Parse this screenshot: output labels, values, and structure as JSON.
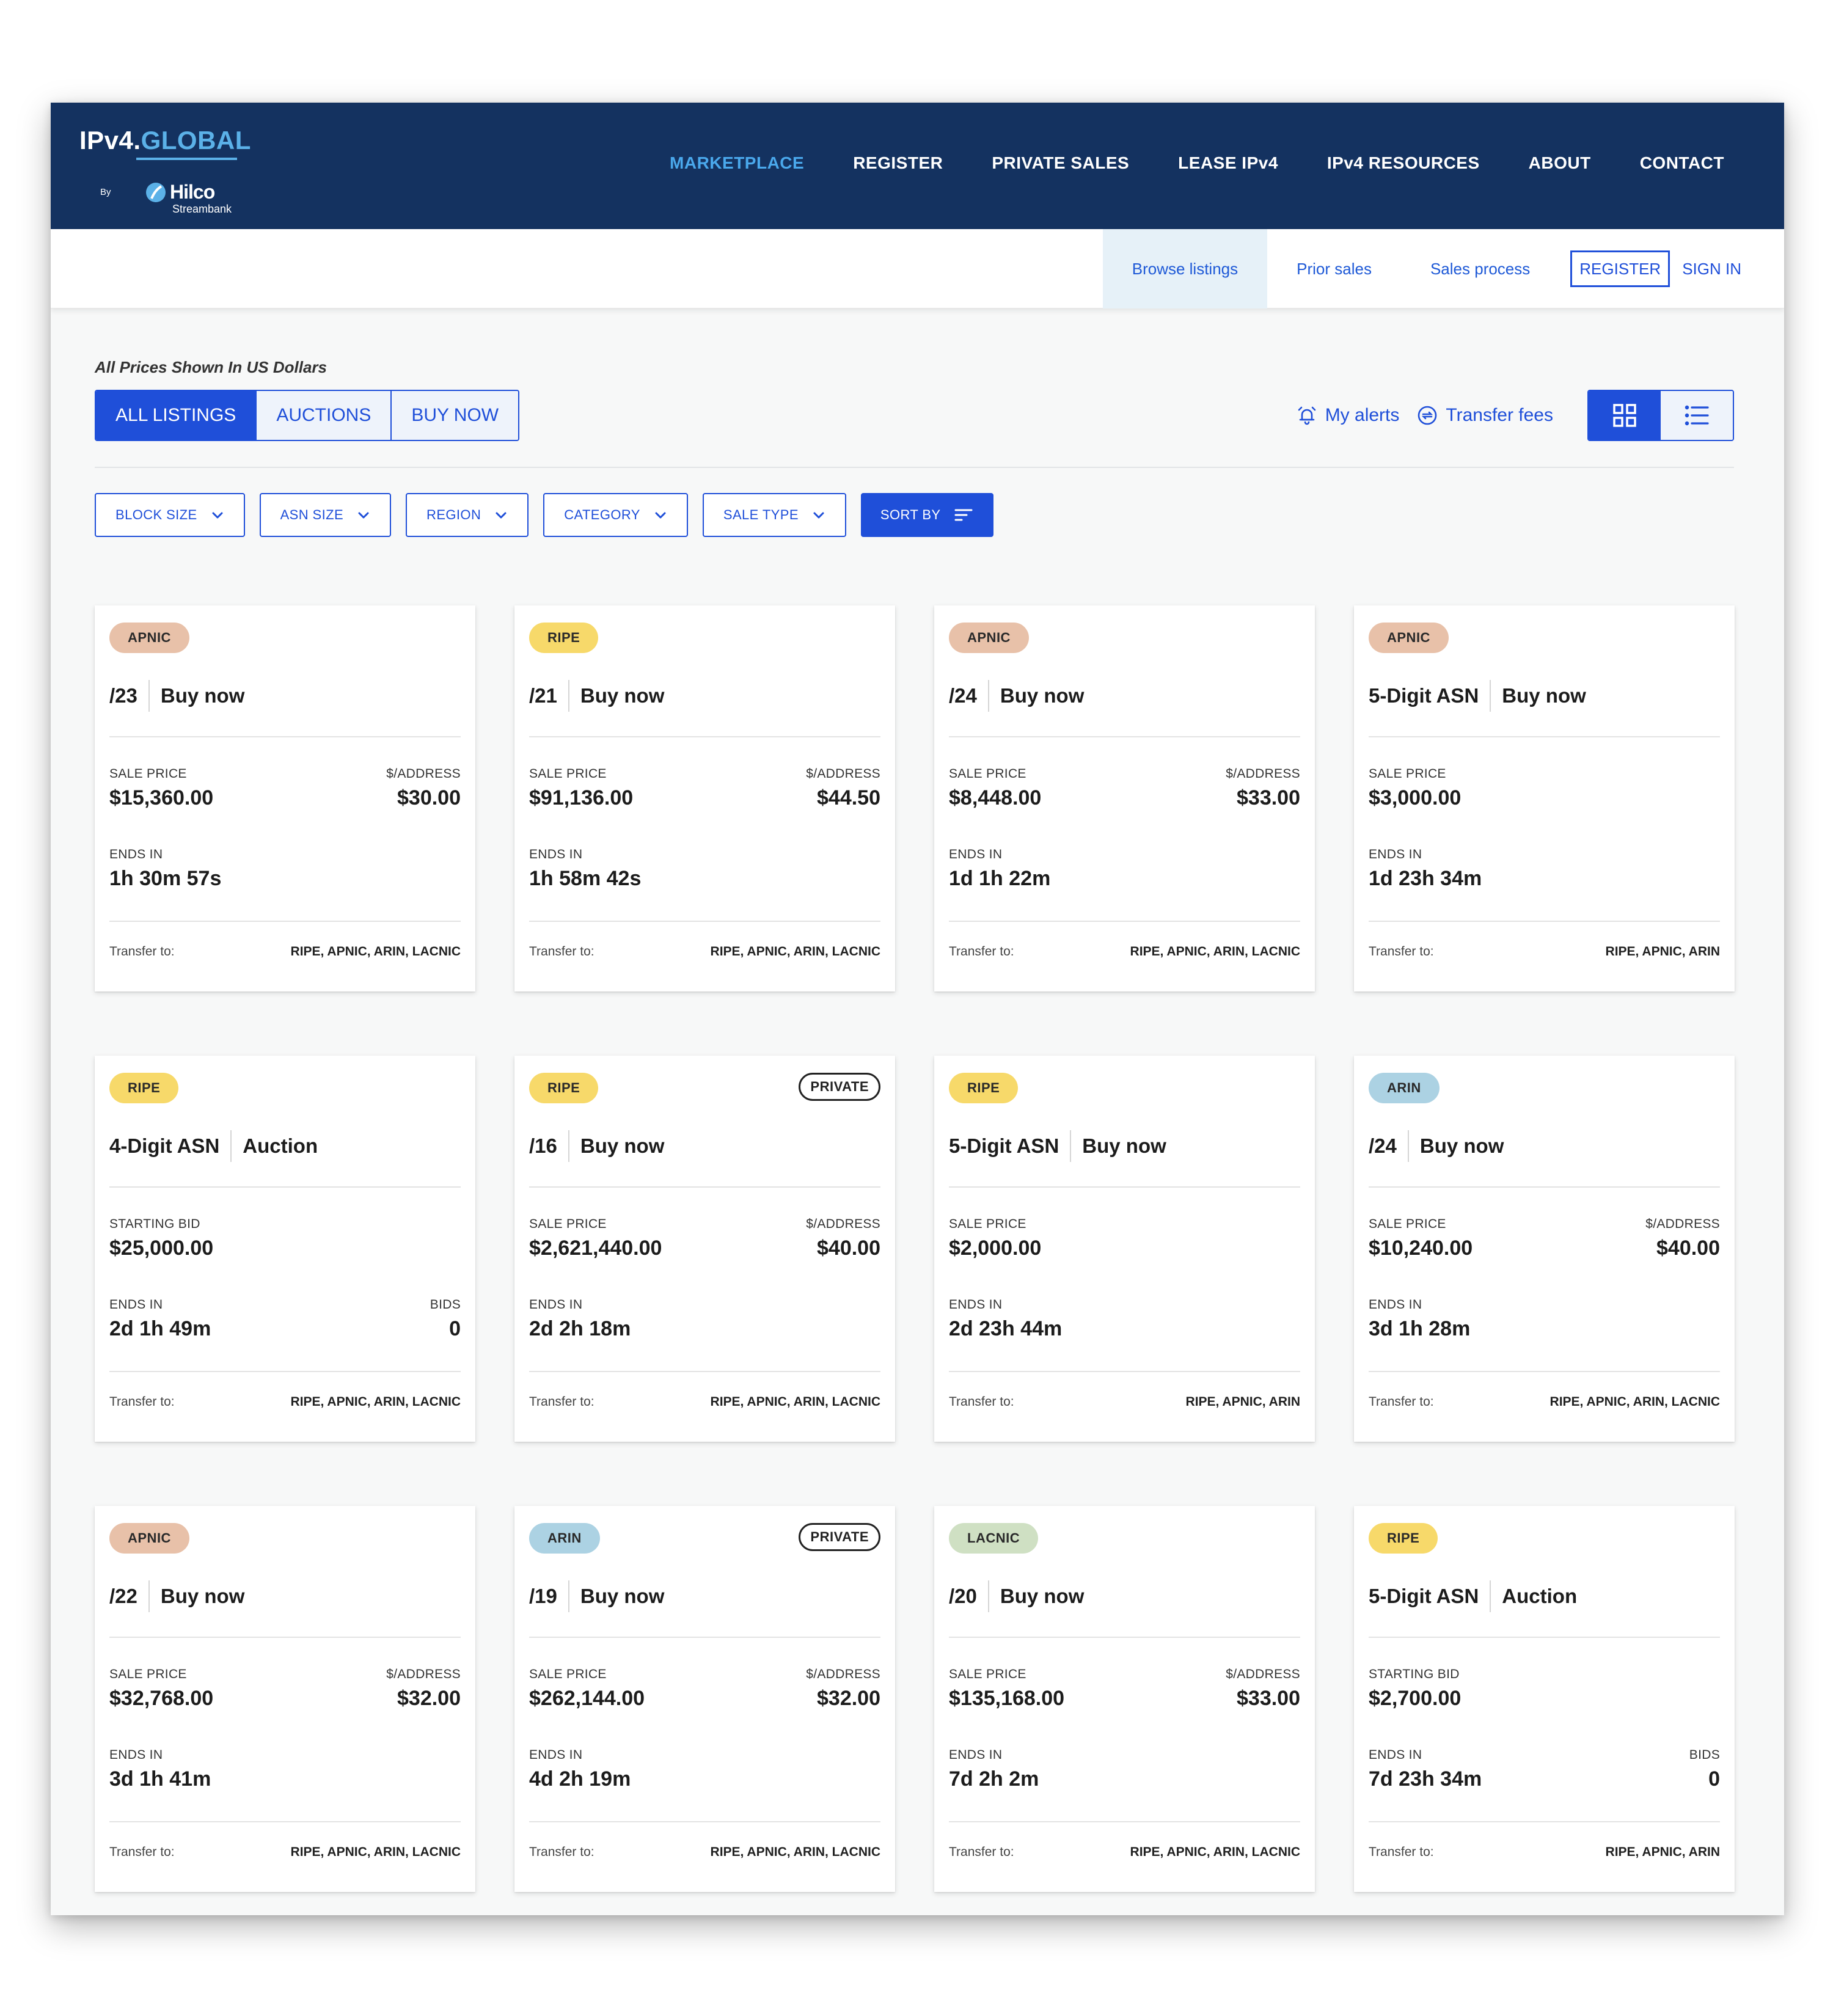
{
  "logo": {
    "part1": "IPv4.",
    "part2": "GLOBAL",
    "by": "By",
    "brand": "Hilco",
    "sub": "Streambank"
  },
  "main_nav": [
    {
      "label": "MARKETPLACE",
      "active": true
    },
    {
      "label": "REGISTER"
    },
    {
      "label": "PRIVATE SALES"
    },
    {
      "label": "LEASE IPv4"
    },
    {
      "label": "IPv4 RESOURCES"
    },
    {
      "label": "ABOUT"
    },
    {
      "label": "CONTACT"
    }
  ],
  "sub_nav": {
    "items": [
      "Browse listings",
      "Prior sales",
      "Sales process"
    ],
    "register": "REGISTER",
    "sign_in": "SIGN IN"
  },
  "prices_note": "All Prices Shown In US Dollars",
  "tabs": [
    "ALL LISTINGS",
    "AUCTIONS",
    "BUY NOW"
  ],
  "tools": {
    "alerts": "My alerts",
    "fees": "Transfer fees"
  },
  "filters": [
    "BLOCK SIZE",
    "ASN SIZE",
    "REGION",
    "CATEGORY",
    "SALE TYPE"
  ],
  "sort_label": "SORT BY",
  "labels": {
    "sale_price": "SALE PRICE",
    "starting_bid": "STARTING BID",
    "per_address": "$/ADDRESS",
    "ends_in": "ENDS IN",
    "bids": "BIDS",
    "transfer_to": "Transfer to:",
    "private": "PRIVATE"
  },
  "colors": {
    "navy": "#143260",
    "accent": "#1f4fd9",
    "nav_active": "#4aa8ec",
    "apnic": "#e8c1a9",
    "ripe": "#f7d96a",
    "arin": "#acd2e3",
    "lacnic": "#cfe0c3"
  },
  "listings": [
    {
      "region": "APNIC",
      "size": "/23",
      "type": "Buy now",
      "price_label": "SALE PRICE",
      "price": "$15,360.00",
      "per_address": "$30.00",
      "ends_in": "1h 30m 57s",
      "transfer": "RIPE, APNIC, ARIN, LACNIC"
    },
    {
      "region": "RIPE",
      "size": "/21",
      "type": "Buy now",
      "price_label": "SALE PRICE",
      "price": "$91,136.00",
      "per_address": "$44.50",
      "ends_in": "1h 58m 42s",
      "transfer": "RIPE, APNIC, ARIN, LACNIC"
    },
    {
      "region": "APNIC",
      "size": "/24",
      "type": "Buy now",
      "price_label": "SALE PRICE",
      "price": "$8,448.00",
      "per_address": "$33.00",
      "ends_in": "1d 1h 22m",
      "transfer": "RIPE, APNIC, ARIN, LACNIC"
    },
    {
      "region": "APNIC",
      "size": "5-Digit ASN",
      "type": "Buy now",
      "price_label": "SALE PRICE",
      "price": "$3,000.00",
      "ends_in": "1d 23h 34m",
      "transfer": "RIPE, APNIC, ARIN"
    },
    {
      "region": "RIPE",
      "size": "4-Digit ASN",
      "type": "Auction",
      "price_label": "STARTING BID",
      "price": "$25,000.00",
      "ends_in": "2d 1h 49m",
      "bids": "0",
      "transfer": "RIPE, APNIC, ARIN, LACNIC"
    },
    {
      "region": "RIPE",
      "private": true,
      "size": "/16",
      "type": "Buy now",
      "price_label": "SALE PRICE",
      "price": "$2,621,440.00",
      "per_address": "$40.00",
      "ends_in": "2d 2h 18m",
      "transfer": "RIPE, APNIC, ARIN, LACNIC"
    },
    {
      "region": "RIPE",
      "size": "5-Digit ASN",
      "type": "Buy now",
      "price_label": "SALE PRICE",
      "price": "$2,000.00",
      "ends_in": "2d 23h 44m",
      "transfer": "RIPE, APNIC, ARIN"
    },
    {
      "region": "ARIN",
      "size": "/24",
      "type": "Buy now",
      "price_label": "SALE PRICE",
      "price": "$10,240.00",
      "per_address": "$40.00",
      "ends_in": "3d 1h 28m",
      "transfer": "RIPE, APNIC, ARIN, LACNIC"
    },
    {
      "region": "APNIC",
      "size": "/22",
      "type": "Buy now",
      "price_label": "SALE PRICE",
      "price": "$32,768.00",
      "per_address": "$32.00",
      "ends_in": "3d 1h 41m",
      "transfer": "RIPE, APNIC, ARIN, LACNIC"
    },
    {
      "region": "ARIN",
      "private": true,
      "size": "/19",
      "type": "Buy now",
      "price_label": "SALE PRICE",
      "price": "$262,144.00",
      "per_address": "$32.00",
      "ends_in": "4d 2h 19m",
      "transfer": "RIPE, APNIC, ARIN, LACNIC"
    },
    {
      "region": "LACNIC",
      "size": "/20",
      "type": "Buy now",
      "price_label": "SALE PRICE",
      "price": "$135,168.00",
      "per_address": "$33.00",
      "ends_in": "7d 2h 2m",
      "transfer": "RIPE, APNIC, ARIN, LACNIC"
    },
    {
      "region": "RIPE",
      "size": "5-Digit ASN",
      "type": "Auction",
      "price_label": "STARTING BID",
      "price": "$2,700.00",
      "ends_in": "7d 23h 34m",
      "bids": "0",
      "transfer": "RIPE, APNIC, ARIN"
    }
  ]
}
